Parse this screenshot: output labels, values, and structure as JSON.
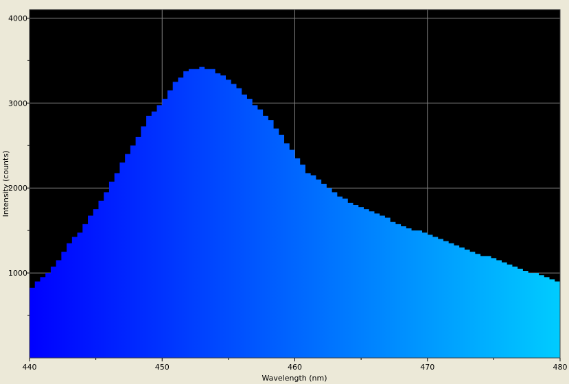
{
  "chart_data": {
    "type": "area",
    "style": "stepped-histogram",
    "xlabel": "Wavelength (nm)",
    "ylabel": "Intensity (counts)",
    "xlim": [
      440,
      480
    ],
    "ylim": [
      0,
      4100
    ],
    "x_ticks": [
      440,
      450,
      460,
      470,
      480
    ],
    "y_ticks": [
      1000,
      2000,
      3000,
      4000
    ],
    "grid": true,
    "colors": {
      "plot_background": "#000000",
      "frame_background": "#ece9d8",
      "grid": "#808080",
      "fill_start": "#0000ff",
      "fill_end": "#00ccff"
    },
    "x": [
      440,
      441,
      442,
      443,
      444,
      445,
      446,
      447,
      448,
      449,
      450,
      451,
      452,
      453,
      454,
      455,
      456,
      457,
      458,
      459,
      460,
      461,
      462,
      463,
      464,
      465,
      466,
      467,
      468,
      469,
      470,
      471,
      472,
      473,
      474,
      475,
      476,
      477,
      478,
      479,
      480
    ],
    "values": [
      780,
      960,
      1090,
      1350,
      1520,
      1760,
      2010,
      2300,
      2540,
      2840,
      3000,
      3250,
      3400,
      3420,
      3380,
      3270,
      3140,
      2980,
      2830,
      2620,
      2400,
      2180,
      2080,
      1950,
      1850,
      1780,
      1720,
      1640,
      1570,
      1510,
      1470,
      1400,
      1340,
      1280,
      1220,
      1170,
      1120,
      1060,
      1000,
      940,
      890
    ]
  }
}
